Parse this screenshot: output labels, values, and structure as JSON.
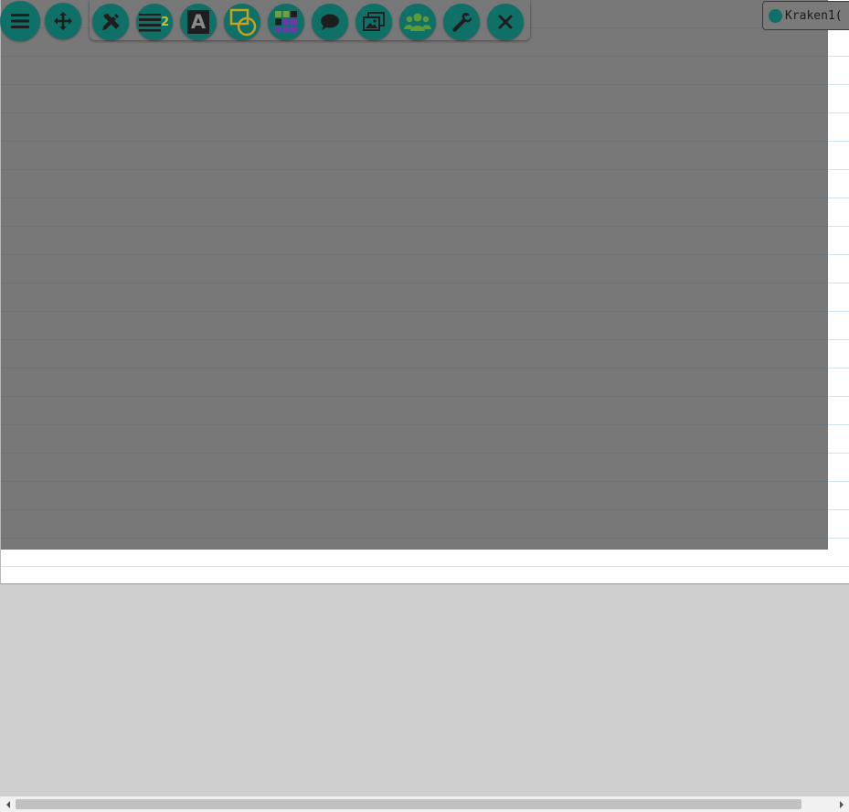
{
  "toolbar": {
    "tools": [
      {
        "name": "menu-button",
        "icon": "hamburger-menu-icon"
      },
      {
        "name": "move-button",
        "icon": "move-arrows-icon"
      },
      {
        "name": "pencil-button",
        "icon": "pencil-ruler-icon"
      },
      {
        "name": "line-width-button",
        "icon": "line-width-icon",
        "badge": "2"
      },
      {
        "name": "text-button",
        "icon": "text-a-icon",
        "glyph": "A"
      },
      {
        "name": "shapes-button",
        "icon": "shapes-icon"
      },
      {
        "name": "colors-button",
        "icon": "color-grid-icon"
      },
      {
        "name": "chat-button",
        "icon": "chat-bubble-icon"
      },
      {
        "name": "images-button",
        "icon": "images-icon"
      },
      {
        "name": "users-button",
        "icon": "users-group-icon"
      },
      {
        "name": "settings-button",
        "icon": "wrench-icon"
      },
      {
        "name": "close-button",
        "icon": "close-x-icon"
      }
    ]
  },
  "user": {
    "label": "Kraken1("
  },
  "colors": {
    "tool_bg": "#0e7066",
    "icon": "#1e1e1e",
    "accent_yellow": "#f2c41a",
    "accent_green": "#7fbe3f",
    "accent_purple": "#8a4fd8",
    "overlay": "#505050"
  }
}
